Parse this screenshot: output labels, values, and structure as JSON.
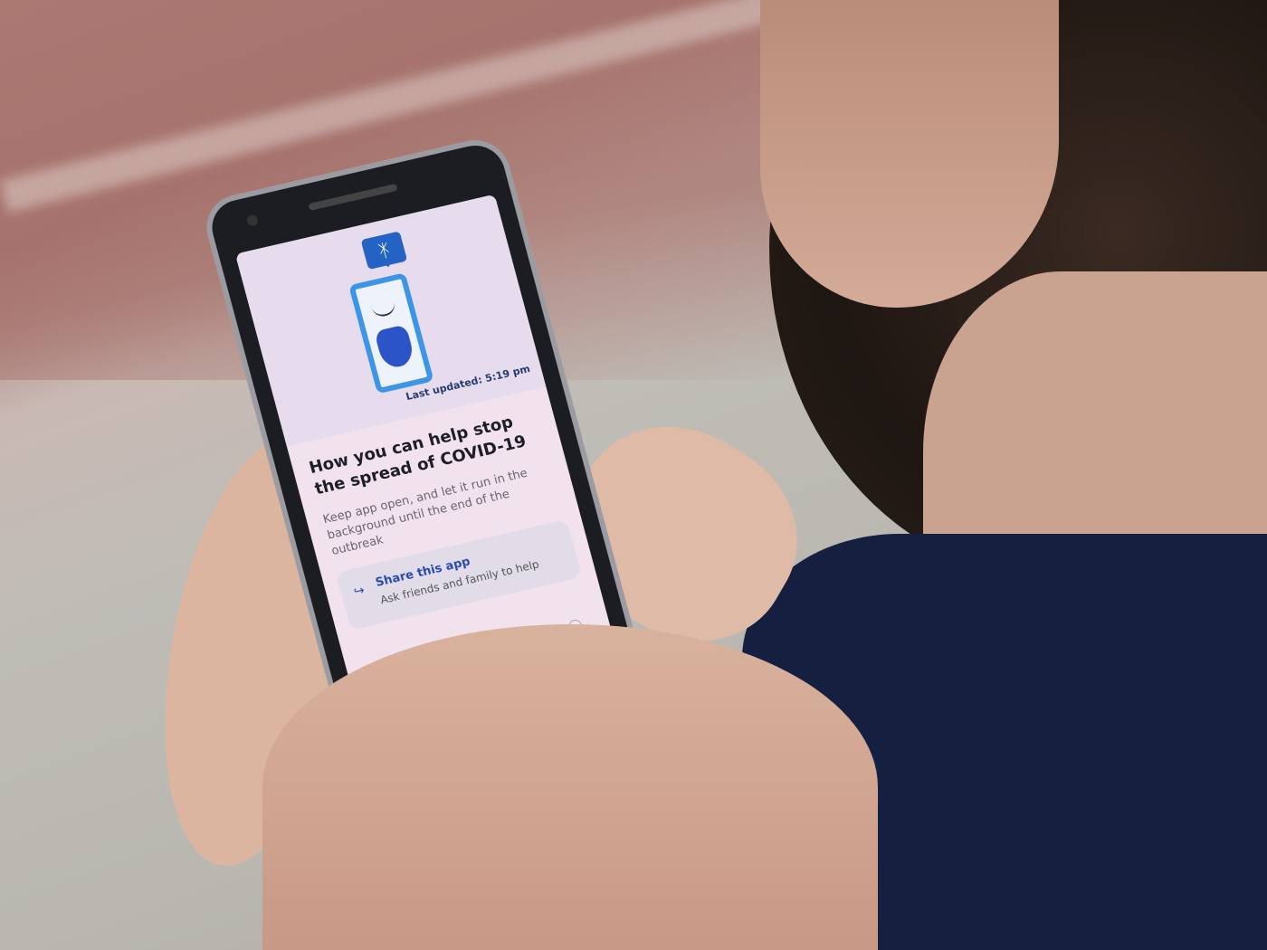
{
  "app": {
    "last_updated": "Last updated: 5:19 pm",
    "title": "How you can help stop the spread of COVID-19",
    "description": "Keep app open, and let it run in the background until the end of the outbreak",
    "share": {
      "label": "Share this app",
      "sublabel": "Ask friends and family to help",
      "icon": "share-icon"
    },
    "bluetooth_icon": "bluetooth-icon",
    "nav_home_icon": "home-icon"
  },
  "colors": {
    "accent": "#2a4ab0",
    "screen_bg": "#f1e2ee",
    "shirt": "#152040"
  }
}
